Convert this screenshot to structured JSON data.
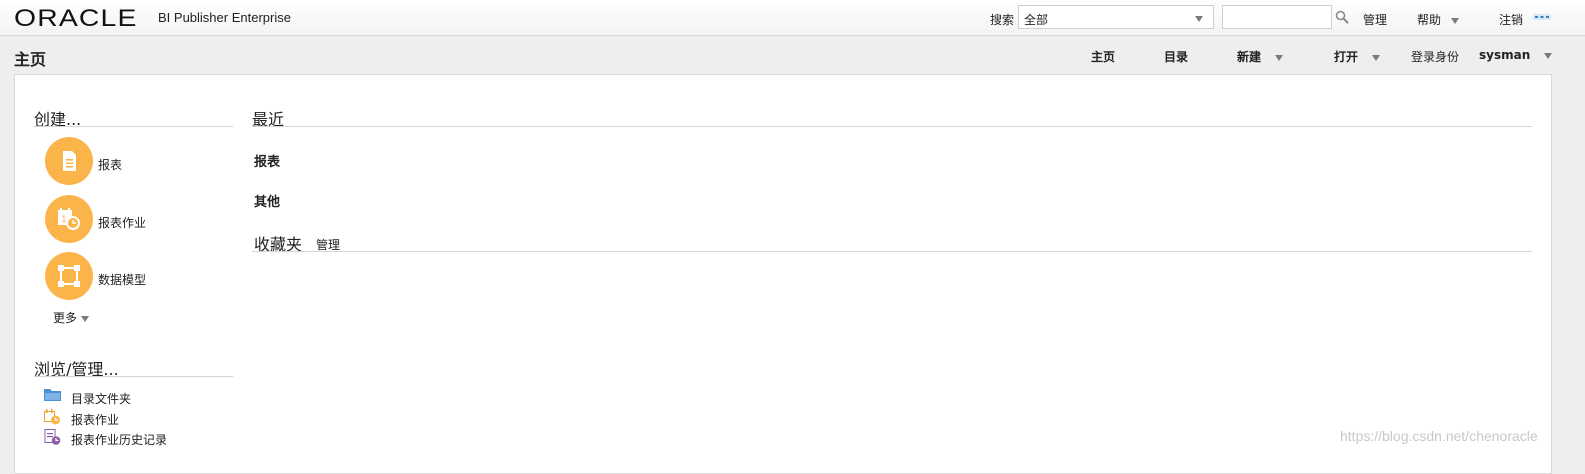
{
  "header": {
    "logo": "ORACLE",
    "product": "BI Publisher Enterprise",
    "search_label": "搜索",
    "search_scope": "全部",
    "search_placeholder": "",
    "admin": "管理",
    "help": "帮助",
    "signout": "注销"
  },
  "page": {
    "title": "主页",
    "nav": {
      "home": "主页",
      "catalog": "目录",
      "new": "新建",
      "open": "打开",
      "signed_in_label": "登录身份",
      "user": "sysman"
    }
  },
  "create": {
    "title": "创建...",
    "items": [
      {
        "label": "报表",
        "icon": "report-icon"
      },
      {
        "label": "报表作业",
        "icon": "report-job-icon"
      },
      {
        "label": "数据模型",
        "icon": "data-model-icon"
      }
    ],
    "more": "更多"
  },
  "browse": {
    "title": "浏览/管理...",
    "items": [
      {
        "label": "目录文件夹",
        "icon": "folder-icon"
      },
      {
        "label": "报表作业",
        "icon": "report-job-icon"
      },
      {
        "label": "报表作业历史记录",
        "icon": "job-history-icon"
      }
    ]
  },
  "recent": {
    "title": "最近",
    "reports": "报表",
    "other": "其他"
  },
  "favorites": {
    "title": "收藏夹",
    "manage": "管理"
  },
  "watermark": "https://blog.csdn.net/chenoracle",
  "colors": {
    "accent_orange": "#fbb44a",
    "folder_blue": "#4a90d9",
    "history_purple": "#8a5ca8"
  }
}
